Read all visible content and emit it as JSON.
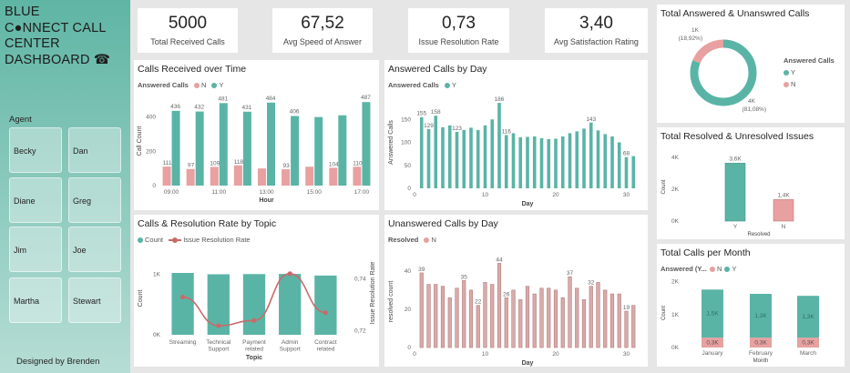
{
  "brand": {
    "line1": "BLUE",
    "line2": "C●NNECT CALL",
    "line3": "CENTER",
    "line4": "DASHBOARD ☎"
  },
  "agent_title": "Agent",
  "agents": [
    "Becky",
    "Dan",
    "Diane",
    "Greg",
    "Jim",
    "Joe",
    "Martha",
    "Stewart"
  ],
  "designed_by": "Designed by  Brenden",
  "colors": {
    "teal": "#5ab4a6",
    "pink": "#e8a0a0",
    "line": "#c96a6a",
    "axis": "#9a9a9a"
  },
  "kpis": [
    {
      "value": "5000",
      "label": "Total Received Calls"
    },
    {
      "value": "67,52",
      "label": "Avg Speed of Answer"
    },
    {
      "value": "0,73",
      "label": "Issue Resolution Rate"
    },
    {
      "value": "3,40",
      "label": "Avg Satisfaction Rating"
    }
  ],
  "legends": {
    "answered": "Answered Calls",
    "n": "N",
    "y": "Y",
    "count": "Count",
    "irr": "Issue Resolution Rate",
    "resolved": "Resolved",
    "answered_trunc": "Answered (Y..."
  },
  "chart_data": [
    {
      "id": "calls_over_time",
      "type": "bar",
      "title": "Calls Received over Time",
      "xlabel": "Hour",
      "ylabel": "Call Count",
      "categories": [
        "09:00",
        "10:00",
        "11:00",
        "12:00",
        "13:00",
        "14:00",
        "15:00",
        "16:00",
        "17:00"
      ],
      "x_tick_labels": [
        "09:00",
        "11:00",
        "13:00",
        "15:00",
        "17:00"
      ],
      "legend_title": "Answered Calls",
      "series": [
        {
          "name": "N",
          "values": [
            111,
            97,
            109,
            118,
            100,
            95,
            110,
            104,
            110
          ]
        },
        {
          "name": "Y",
          "values": [
            436,
            432,
            481,
            431,
            484,
            406,
            400,
            410,
            487
          ]
        }
      ],
      "data_labels": {
        "N": [
          "111",
          "97",
          "109",
          "118",
          "",
          "93",
          "",
          "104",
          "110"
        ],
        "Y": [
          "436",
          "432",
          "481",
          "431",
          "484",
          "406",
          "",
          "",
          "487"
        ]
      },
      "yticks": [
        "0",
        "200",
        "400"
      ],
      "ylim": [
        0,
        520
      ]
    },
    {
      "id": "answered_by_day",
      "type": "bar",
      "title": "Answered Calls by Day",
      "xlabel": "Day",
      "ylabel": "Answered Calls",
      "legend_title": "Answered Calls",
      "x": [
        1,
        2,
        3,
        4,
        5,
        6,
        7,
        8,
        9,
        10,
        11,
        12,
        13,
        14,
        15,
        16,
        17,
        18,
        19,
        20,
        21,
        22,
        23,
        24,
        25,
        26,
        27,
        28,
        29,
        30,
        31
      ],
      "values": [
        155,
        129,
        158,
        133,
        137,
        123,
        127,
        132,
        127,
        137,
        150,
        186,
        116,
        120,
        111,
        112,
        113,
        109,
        107,
        108,
        113,
        120,
        124,
        130,
        143,
        126,
        118,
        113,
        100,
        68,
        70
      ],
      "labels": {
        "1": "155",
        "2": "129",
        "3": "158",
        "6": "123",
        "12": "186",
        "13": "116",
        "25": "143",
        "30": "68"
      },
      "xticks": [
        "0",
        "10",
        "20",
        "30"
      ],
      "yticks": [
        "0",
        "50",
        "100",
        "150"
      ],
      "ylim": [
        0,
        200
      ],
      "xlim": [
        0,
        32
      ]
    },
    {
      "id": "donut",
      "type": "pie",
      "title": "Total Answered & Unanswred Calls",
      "legend_title": "Answered Calls",
      "slices": [
        {
          "name": "Y",
          "value": 4054,
          "label": "4K",
          "pct": "(81,08%)"
        },
        {
          "name": "N",
          "value": 946,
          "label": "1K",
          "pct": "(18,92%)"
        }
      ]
    },
    {
      "id": "topic",
      "type": "bar",
      "title": "Calls & Resolution Rate by Topic",
      "xlabel": "Topic",
      "ylabel": "Count",
      "y2label": "Issue Resolution Rate",
      "categories": [
        "Streaming",
        "Technical Support",
        "Payment related",
        "Admin Support",
        "Contract related"
      ],
      "category_lines": [
        [
          "Streaming"
        ],
        [
          "Technical",
          "Support"
        ],
        [
          "Payment",
          "related"
        ],
        [
          "Admin",
          "Support"
        ],
        [
          "Contract",
          "related"
        ]
      ],
      "series": [
        {
          "name": "Count",
          "values": [
            1020,
            998,
            1001,
            1004,
            977
          ]
        },
        {
          "name": "Issue Resolution Rate",
          "values": [
            0.733,
            0.722,
            0.724,
            0.742,
            0.727
          ]
        }
      ],
      "yticks": [
        "0K",
        "1K"
      ],
      "y2ticks": [
        "0,72",
        "0,74"
      ],
      "ylim": [
        0,
        1200
      ],
      "y2lim": [
        0.7185,
        0.7465
      ]
    },
    {
      "id": "unanswered_by_day",
      "type": "bar",
      "title": "Unanswered Calls by Day",
      "xlabel": "Day",
      "ylabel": "resolved count",
      "legend_title": "Resolved",
      "x": [
        1,
        2,
        3,
        4,
        5,
        6,
        7,
        8,
        9,
        10,
        11,
        12,
        13,
        14,
        15,
        16,
        17,
        18,
        19,
        20,
        21,
        22,
        23,
        24,
        25,
        26,
        27,
        28,
        29,
        30,
        31
      ],
      "values": [
        39,
        33,
        33,
        32,
        26,
        31,
        35,
        30,
        22,
        34,
        33,
        44,
        26,
        30,
        25,
        32,
        28,
        31,
        31,
        30,
        26,
        37,
        31,
        25,
        32,
        34,
        30,
        28,
        28,
        19,
        22
      ],
      "labels": {
        "1": "39",
        "7": "35",
        "9": "22",
        "12": "44",
        "13": "26",
        "22": "37",
        "25": "32",
        "30": "19"
      },
      "xticks": [
        "0",
        "10",
        "20",
        "30"
      ],
      "yticks": [
        "0",
        "20",
        "40"
      ],
      "ylim": [
        0,
        48
      ],
      "xlim": [
        0,
        32
      ]
    },
    {
      "id": "resolved",
      "type": "bar",
      "title": "Total Resolved & Unresolved Issues",
      "xlabel": "Resolved",
      "ylabel": "Count",
      "categories": [
        "Y",
        "N"
      ],
      "values": [
        3646,
        1354
      ],
      "labels": [
        "3,6K",
        "1,4K"
      ],
      "yticks": [
        "0K",
        "2K",
        "4K"
      ],
      "ylim": [
        0,
        4300
      ]
    },
    {
      "id": "per_month",
      "type": "bar",
      "title": "Total Calls per Month",
      "xlabel": "Month",
      "ylabel": "Count",
      "legend_title": "Answered (Y...",
      "categories": [
        "January",
        "February",
        "March"
      ],
      "series": [
        {
          "name": "N",
          "values": [
            300,
            300,
            300
          ]
        },
        {
          "name": "Y",
          "values": [
            1460,
            1330,
            1270
          ]
        }
      ],
      "labels": {
        "N": [
          "0,3K",
          "0,3K",
          "0,3K"
        ],
        "Y": [
          "1,5K",
          "1,3K",
          "1,3K"
        ]
      },
      "yticks": [
        "0K",
        "1K",
        "2K"
      ],
      "ylim": [
        0,
        2100
      ]
    }
  ]
}
